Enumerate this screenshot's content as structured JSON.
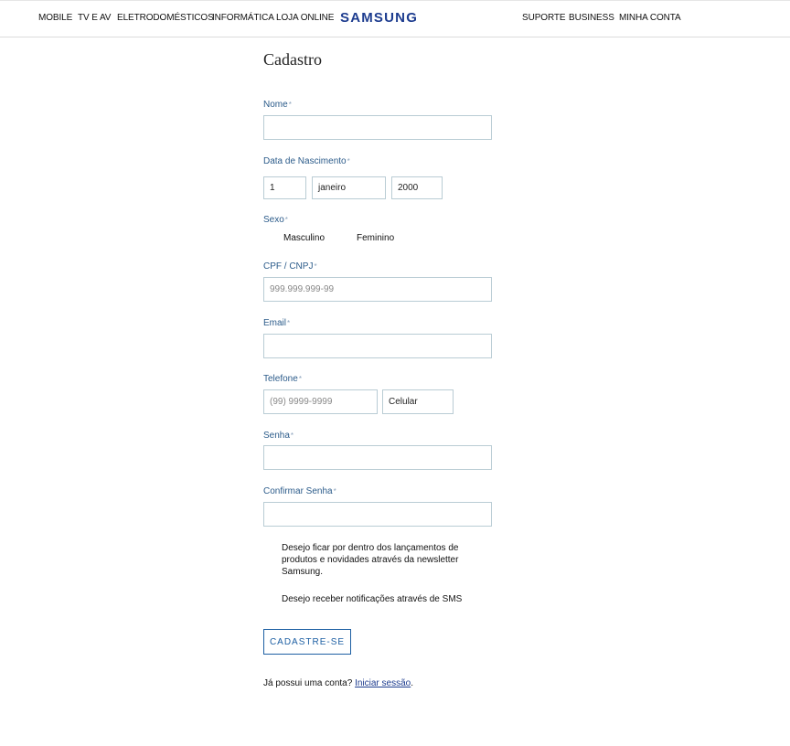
{
  "nav": {
    "left_items": [
      "MOBILE",
      "TV E AV",
      "ELETRODOMÉSTICOS",
      "INFORMÁTICA",
      "LOJA ONLINE"
    ],
    "logo": "SAMSUNG",
    "right_items": [
      "SUPORTE",
      "BUSINESS",
      "MINHA CONTA"
    ]
  },
  "form": {
    "title": "Cadastro",
    "required_mark": "*",
    "name": {
      "label": "Nome",
      "value": ""
    },
    "birth": {
      "label": "Data de Nascimento",
      "day": "1",
      "month": "janeiro",
      "year": "2000"
    },
    "sex": {
      "label": "Sexo",
      "options": [
        "Masculino",
        "Feminino"
      ]
    },
    "cpf": {
      "label": "CPF / CNPJ",
      "placeholder": "999.999.999-99"
    },
    "email": {
      "label": "Email",
      "value": ""
    },
    "phone": {
      "label": "Telefone",
      "placeholder": "(99) 9999-9999",
      "type": "Celular"
    },
    "password": {
      "label": "Senha",
      "value": ""
    },
    "confirm_password": {
      "label": "Confirmar Senha",
      "value": ""
    },
    "newsletter_text": "Desejo ficar por dentro dos lançamentos de produtos e novidades através da newsletter Samsung.",
    "sms_text": "Desejo receber notificações através de SMS",
    "submit_label": "CADASTRE-SE",
    "login_prompt": "Já possui uma conta?",
    "login_link": "Iniciar sessão",
    "login_suffix": "."
  },
  "colors": {
    "label": "#2b5b8a",
    "brand": "#1d3c8f",
    "button": "#1d5fa3",
    "border": "#b9ccd4"
  }
}
